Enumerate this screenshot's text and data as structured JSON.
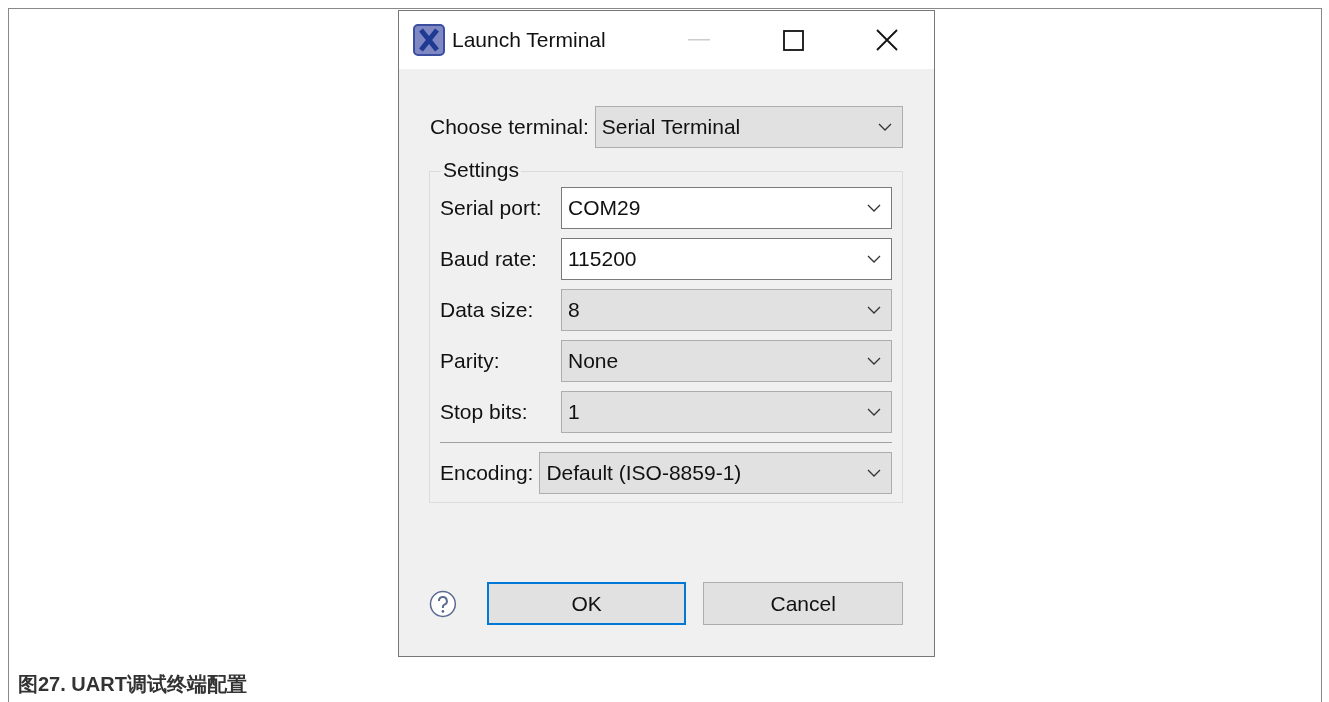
{
  "window": {
    "title": "Launch Terminal"
  },
  "choose_terminal": {
    "label": "Choose terminal:",
    "value": "Serial Terminal"
  },
  "settings": {
    "title": "Settings",
    "fields": [
      {
        "label": "Serial port:",
        "value": "COM29",
        "editable": true
      },
      {
        "label": "Baud rate:",
        "value": "115200",
        "editable": true
      },
      {
        "label": "Data size:",
        "value": "8",
        "editable": false
      },
      {
        "label": "Parity:",
        "value": "None",
        "editable": false
      },
      {
        "label": "Stop bits:",
        "value": "1",
        "editable": false
      }
    ],
    "encoding": {
      "label": "Encoding:",
      "value": "Default (ISO-8859-1)"
    }
  },
  "buttons": [
    {
      "label": "OK",
      "selected": true
    },
    {
      "label": "Cancel",
      "selected": false
    }
  ],
  "caption": "图27. UART调试终端配置"
}
